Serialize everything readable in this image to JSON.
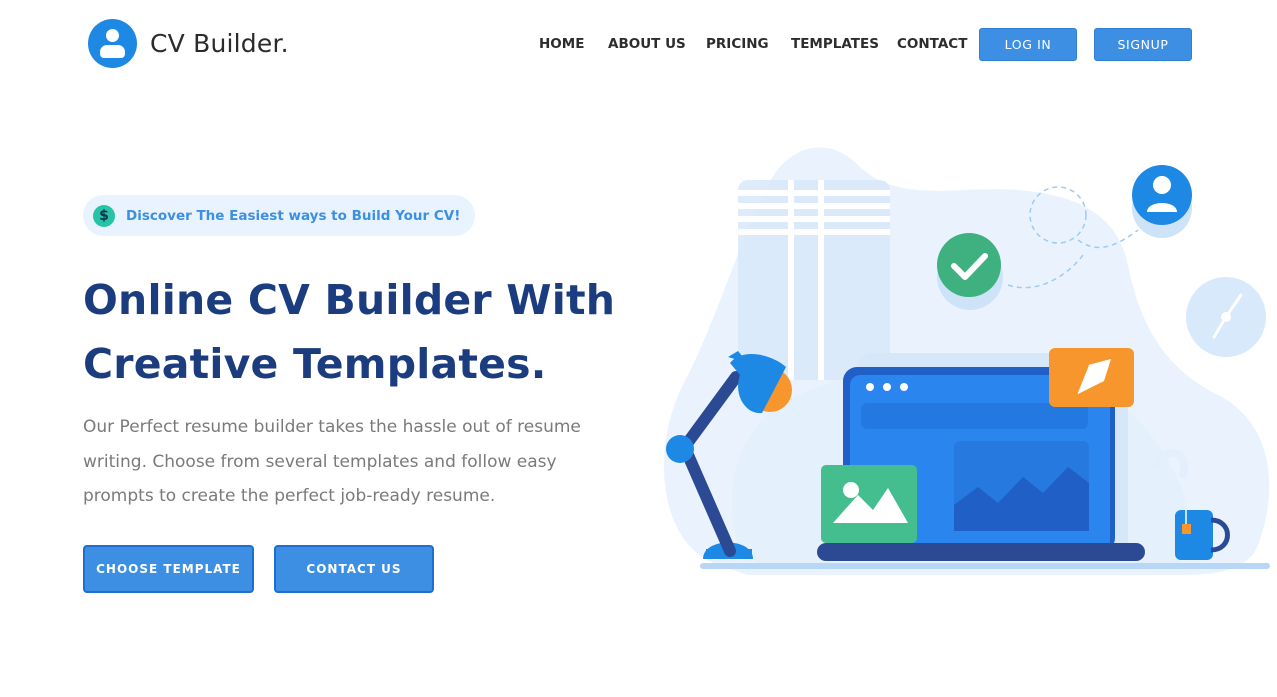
{
  "brand": {
    "name": "CV Builder.",
    "icon": "user-icon",
    "color": "#1e88e5"
  },
  "nav": {
    "items": [
      "HOME",
      "ABOUT US",
      "PRICING",
      "TEMPLATES",
      "CONTACT"
    ],
    "login_label": "LOG IN",
    "signup_label": "SIGNUP"
  },
  "hero": {
    "badge_icon": "dollar-icon",
    "badge_text": "Discover The Easiest ways to Build Your CV!",
    "title_line1": "Online CV Builder With",
    "title_line2": "Creative Templates.",
    "description": "Our Perfect resume builder takes the hassle out of resume writing. Choose from several templates and follow easy prompts to create the perfect job-ready resume.",
    "primary_button": "CHOOSE TEMPLATE",
    "secondary_button": "CONTACT US"
  },
  "colors": {
    "accent": "#3d8fe4",
    "title": "#1b3d7f",
    "text": "#7a7a7a",
    "success": "#3fb07f",
    "warning": "#f6962c"
  }
}
